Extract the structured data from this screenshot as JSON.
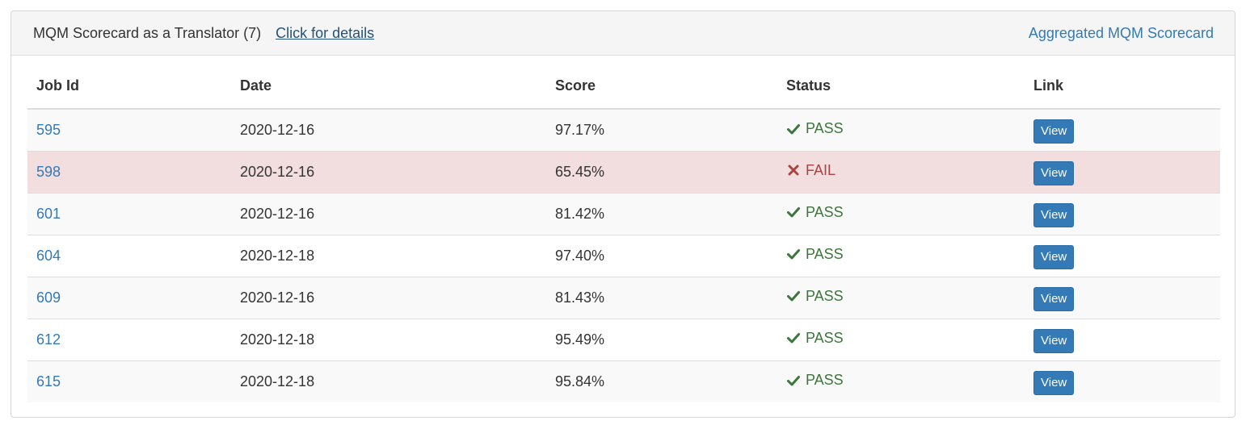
{
  "panel": {
    "title": "MQM Scorecard as a Translator (7)",
    "details_link": "Click for details",
    "aggregated_link": "Aggregated MQM Scorecard"
  },
  "table": {
    "headers": [
      "Job Id",
      "Date",
      "Score",
      "Status",
      "Link"
    ],
    "rows": [
      {
        "job_id": "595",
        "date": "2020-12-16",
        "score": "97.17%",
        "status": "PASS",
        "status_type": "pass",
        "link_label": "View"
      },
      {
        "job_id": "598",
        "date": "2020-12-16",
        "score": "65.45%",
        "status": "FAIL",
        "status_type": "fail",
        "link_label": "View"
      },
      {
        "job_id": "601",
        "date": "2020-12-16",
        "score": "81.42%",
        "status": "PASS",
        "status_type": "pass",
        "link_label": "View"
      },
      {
        "job_id": "604",
        "date": "2020-12-18",
        "score": "97.40%",
        "status": "PASS",
        "status_type": "pass",
        "link_label": "View"
      },
      {
        "job_id": "609",
        "date": "2020-12-16",
        "score": "81.43%",
        "status": "PASS",
        "status_type": "pass",
        "link_label": "View"
      },
      {
        "job_id": "612",
        "date": "2020-12-18",
        "score": "95.49%",
        "status": "PASS",
        "status_type": "pass",
        "link_label": "View"
      },
      {
        "job_id": "615",
        "date": "2020-12-18",
        "score": "95.84%",
        "status": "PASS",
        "status_type": "pass",
        "link_label": "View"
      }
    ]
  },
  "icons": {
    "pass": "check-icon",
    "fail": "cross-icon"
  },
  "colors": {
    "link": "#337ab7",
    "pass": "#3c763d",
    "fail": "#a94442",
    "fail_row": "#f2dede",
    "button": "#337ab7"
  }
}
